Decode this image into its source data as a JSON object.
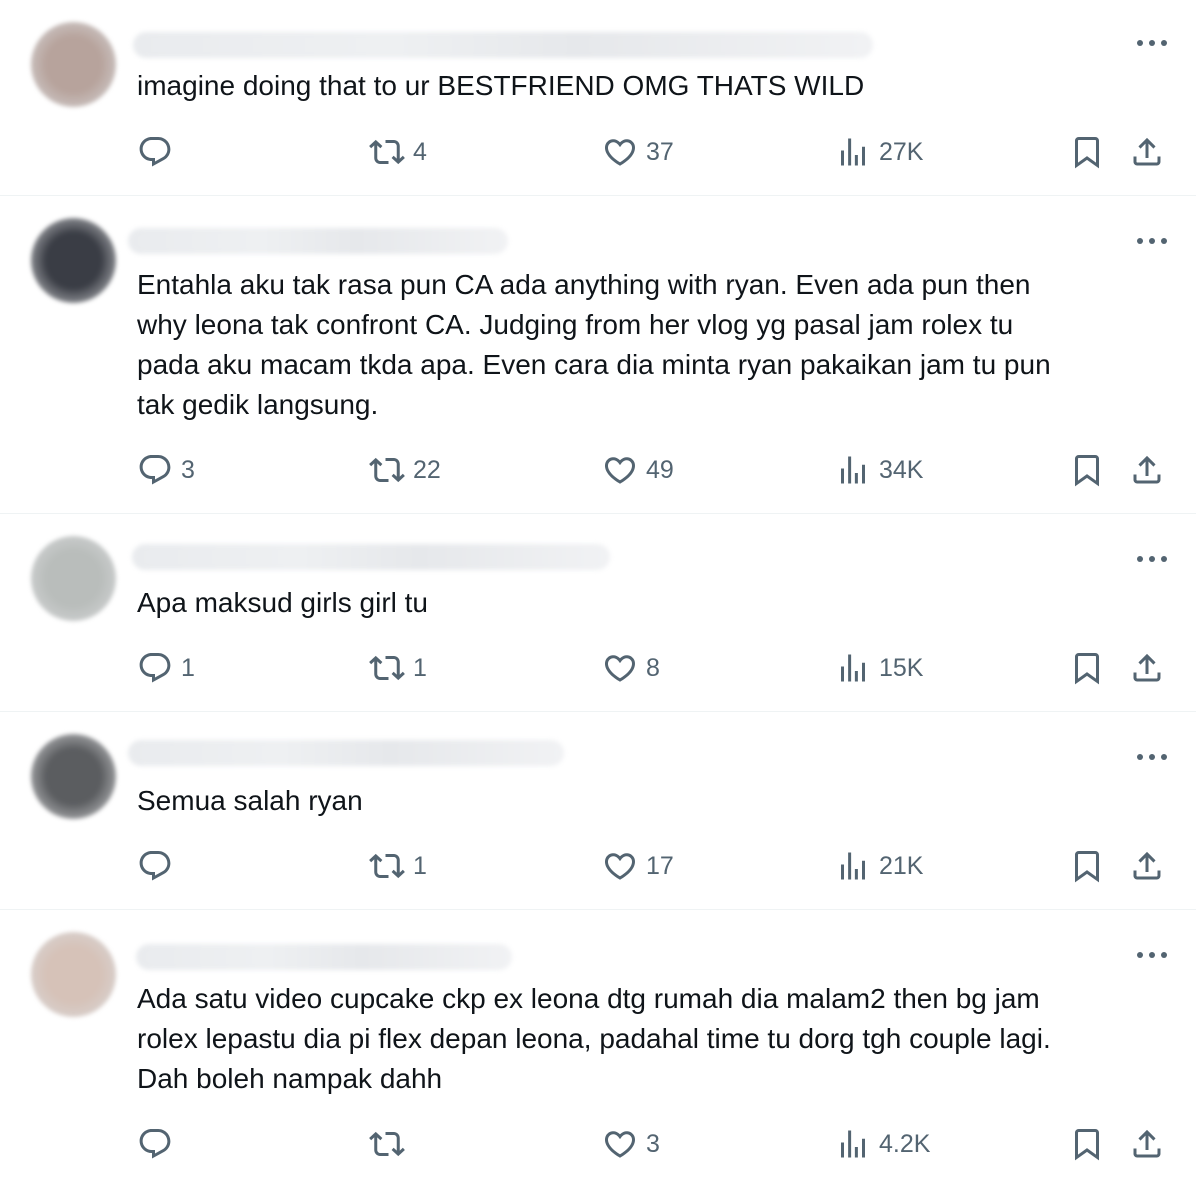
{
  "posts": [
    {
      "text": "imagine doing that to ur BESTFRIEND OMG THATS WILD",
      "avatar_color": "#b7a39c",
      "replies": "",
      "reposts": "4",
      "likes": "37",
      "views": "27K"
    },
    {
      "text": "Entahla aku tak rasa pun CA ada anything with ryan. Even ada pun then\nwhy leona tak confront CA. Judging from her vlog yg pasal jam rolex tu\npada aku macam tkda apa. Even cara dia minta ryan pakaikan jam tu pun\ntak gedik langsung.",
      "avatar_color": "#3a3d45",
      "replies": "3",
      "reposts": "22",
      "likes": "49",
      "views": "34K"
    },
    {
      "text": "Apa maksud girls girl tu",
      "avatar_color": "#b9bdbb",
      "replies": "1",
      "reposts": "1",
      "likes": "8",
      "views": "15K"
    },
    {
      "text": "Semua salah ryan",
      "avatar_color": "#5b5d60",
      "replies": "",
      "reposts": "1",
      "likes": "17",
      "views": "21K"
    },
    {
      "text": "Ada satu video cupcake ckp ex leona dtg rumah dia malam2 then bg jam\nrolex lepastu dia pi flex depan leona, padahal time tu dorg tgh couple lagi.\nDah boleh nampak dahh",
      "avatar_color": "#d6c2b8",
      "replies": "",
      "reposts": "",
      "likes": "3",
      "views": "4.2K"
    }
  ],
  "icons": {
    "reply": "reply-icon",
    "repost": "repost-icon",
    "like": "heart-icon",
    "views": "views-icon",
    "bookmark": "bookmark-icon",
    "share": "share-icon",
    "more": "more-icon"
  },
  "colors": {
    "text": "#0f1419",
    "secondary": "#536471",
    "divider": "#eff3f4"
  }
}
